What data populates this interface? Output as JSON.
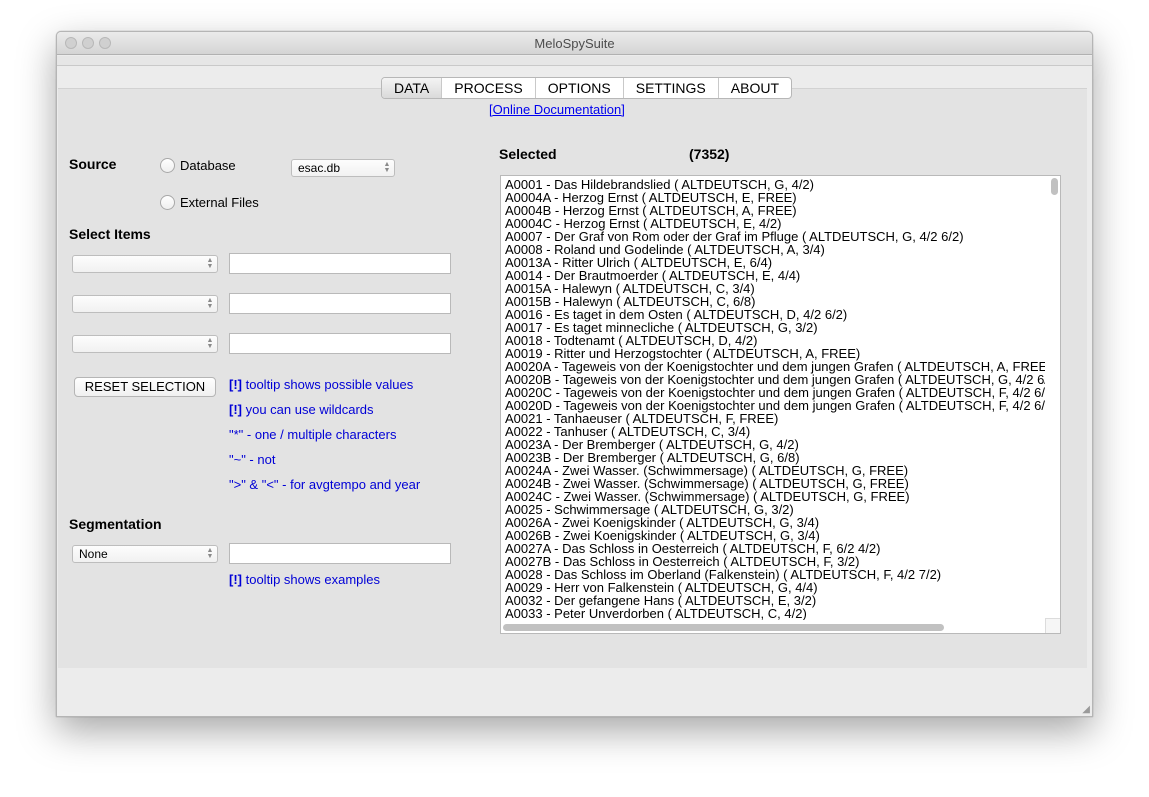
{
  "window": {
    "title": "MeloSpySuite"
  },
  "tabs": [
    {
      "label": "DATA",
      "active": true
    },
    {
      "label": "PROCESS"
    },
    {
      "label": "OPTIONS"
    },
    {
      "label": "SETTINGS"
    },
    {
      "label": "ABOUT"
    }
  ],
  "doc_link": "[Online Documentation]",
  "source": {
    "heading": "Source",
    "database_label": "Database",
    "database_value": "esac.db",
    "external_label": "External Files"
  },
  "select_items": {
    "heading": "Select Items",
    "rows": [
      {
        "combo_value": "",
        "input_value": ""
      },
      {
        "combo_value": "",
        "input_value": ""
      },
      {
        "combo_value": "",
        "input_value": ""
      }
    ],
    "reset_label": "RESET SELECTION",
    "hint1_mark": "[!]",
    "hint1_text": " tooltip shows possible values",
    "hint2_mark": "[!]",
    "hint2_text": " you can use wildcards",
    "hint3": "\"*\" - one / multiple characters",
    "hint4": "\"~\" - not",
    "hint5": "\">\" & \"<\" - for avgtempo and year"
  },
  "segmentation": {
    "heading": "Segmentation",
    "combo_value": "None",
    "input_value": "",
    "hint_mark": "[!]",
    "hint_text": " tooltip shows examples"
  },
  "selected": {
    "heading": "Selected",
    "count": "(7352)",
    "items": [
      "A0001 - Das Hildebrandslied ( ALTDEUTSCH, G, 4/2)",
      "A0004A - Herzog Ernst ( ALTDEUTSCH, E, FREE)",
      "A0004B - Herzog Ernst ( ALTDEUTSCH, A, FREE)",
      "A0004C - Herzog Ernst ( ALTDEUTSCH, E, 4/2)",
      "A0007 - Der Graf von Rom oder der Graf im Pfluge ( ALTDEUTSCH, G, 4/2 6/2)",
      "A0008 - Roland und Godelinde ( ALTDEUTSCH, A, 3/4)",
      "A0013A - Ritter Ulrich ( ALTDEUTSCH, E, 6/4)",
      "A0014 - Der Brautmoerder ( ALTDEUTSCH, E, 4/4)",
      "A0015A - Halewyn ( ALTDEUTSCH, C, 3/4)",
      "A0015B - Halewyn ( ALTDEUTSCH, C, 6/8)",
      "A0016 - Es taget in dem Osten ( ALTDEUTSCH, D, 4/2 6/2)",
      "A0017 - Es taget minnecliche ( ALTDEUTSCH, G, 3/2)",
      "A0018 - Todtenamt ( ALTDEUTSCH, D, 4/2)",
      "A0019 - Ritter und Herzogstochter ( ALTDEUTSCH, A, FREE)",
      "A0020A - Tageweis von der Koenigstochter und dem jungen Grafen ( ALTDEUTSCH, A, FREE",
      "A0020B - Tageweis von der Koenigstochter und dem jungen Grafen ( ALTDEUTSCH, G, 4/2 6/",
      "A0020C - Tageweis von der Koenigstochter und dem jungen Grafen ( ALTDEUTSCH, F, 4/2 6/",
      "A0020D - Tageweis von der Koenigstochter und dem jungen Grafen ( ALTDEUTSCH, F, 4/2 6/",
      "A0021 - Tanhaeuser ( ALTDEUTSCH, F, FREE)",
      "A0022 - Tanhuser ( ALTDEUTSCH, C, 3/4)",
      "A0023A - Der Bremberger ( ALTDEUTSCH, G, 4/2)",
      "A0023B - Der Bremberger ( ALTDEUTSCH, G, 6/8)",
      "A0024A - Zwei Wasser. (Schwimmersage) ( ALTDEUTSCH, G, FREE)",
      "A0024B - Zwei Wasser. (Schwimmersage) ( ALTDEUTSCH, G, FREE)",
      "A0024C - Zwei Wasser. (Schwimmersage) ( ALTDEUTSCH, G, FREE)",
      "A0025 - Schwimmersage ( ALTDEUTSCH, G, 3/2)",
      "A0026A - Zwei Koenigskinder ( ALTDEUTSCH, G, 3/4)",
      "A0026B - Zwei Koenigskinder ( ALTDEUTSCH, G, 3/4)",
      "A0027A - Das Schloss in Oesterreich ( ALTDEUTSCH, F, 6/2 4/2)",
      "A0027B - Das Schloss in Oesterreich ( ALTDEUTSCH, F, 3/2)",
      "A0028 - Das Schloss im Oberland (Falkenstein) ( ALTDEUTSCH, F, 4/2 7/2)",
      "A0029 - Herr von Falkenstein ( ALTDEUTSCH, G, 4/4)",
      "A0032 - Der gefangene Hans ( ALTDEUTSCH, E, 3/2)",
      "A0033 - Peter Unverdorben ( ALTDEUTSCH, C, 4/2)"
    ]
  }
}
